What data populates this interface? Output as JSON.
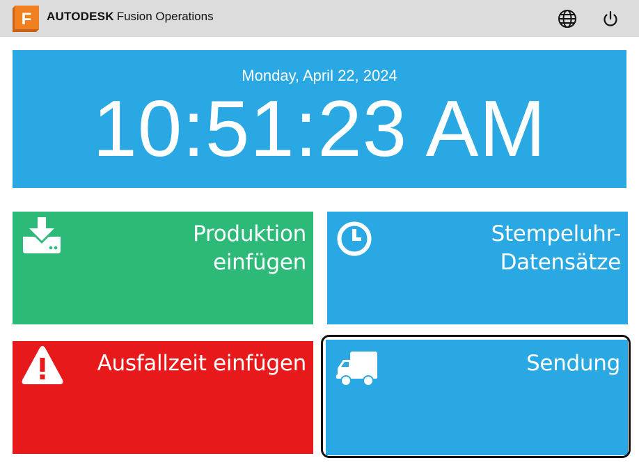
{
  "header": {
    "logo_letter": "F",
    "brand_bold": "AUTODESK",
    "brand_product": "Fusion Operations",
    "icons": [
      "globe-icon",
      "power-icon"
    ]
  },
  "clock": {
    "date": "Monday, April 22, 2024",
    "time": "10:51:23 AM"
  },
  "tiles": [
    {
      "label_lines": [
        "Produktion",
        "einfügen"
      ],
      "icon": "download-icon",
      "color": "#2dba78"
    },
    {
      "label_lines": [
        "Stempeluhr-",
        "Datensätze"
      ],
      "icon": "clock-icon",
      "color": "#29a8e3"
    },
    {
      "label_lines": [
        "Ausfallzeit einfügen"
      ],
      "icon": "warning-icon",
      "color": "#e8191b"
    },
    {
      "label_lines": [
        "Sendung"
      ],
      "icon": "truck-icon",
      "color": "#29a8e3",
      "focused": true
    }
  ],
  "colors": {
    "topbar": "#dcdcdc",
    "accent_blue": "#29a8e3",
    "green": "#2dba78",
    "red": "#e8191b",
    "logo_orange": "#f07f1f"
  }
}
